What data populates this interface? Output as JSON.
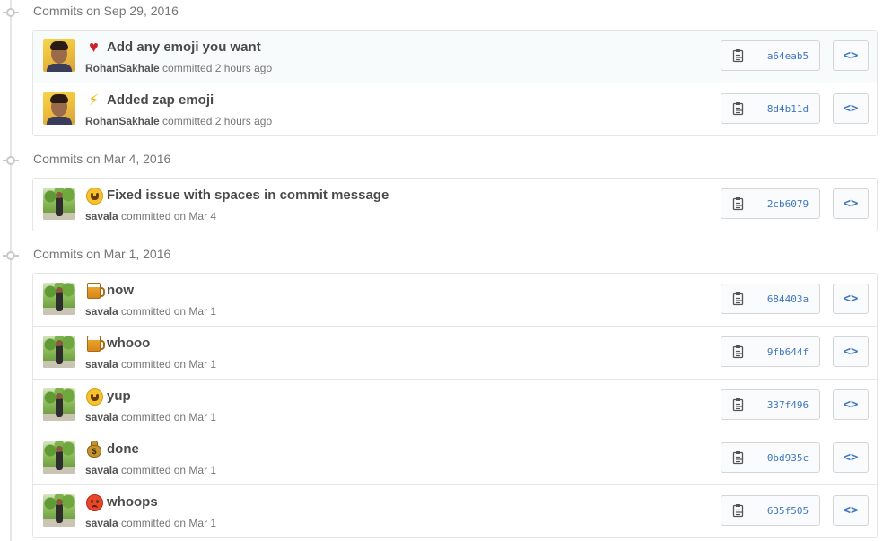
{
  "groups": [
    {
      "title": "Commits on Sep 29, 2016",
      "commits": [
        {
          "emoji": "heart",
          "message": "Add any emoji you want",
          "author": "RohanSakhale",
          "verb": "committed",
          "when": "2 hours ago",
          "sha": "a64eab5",
          "avatar": "rohan"
        },
        {
          "emoji": "zap",
          "message": "Added zap emoji",
          "author": "RohanSakhale",
          "verb": "committed",
          "when": "2 hours ago",
          "sha": "8d4b11d",
          "avatar": "rohan"
        }
      ]
    },
    {
      "title": "Commits on Mar 4, 2016",
      "commits": [
        {
          "emoji": "smiley",
          "message": "Fixed issue with spaces in commit message",
          "author": "savala",
          "verb": "committed",
          "when": "on Mar 4",
          "sha": "2cb6079",
          "avatar": "savala"
        }
      ]
    },
    {
      "title": "Commits on Mar 1, 2016",
      "commits": [
        {
          "emoji": "beer",
          "message": "now",
          "author": "savala",
          "verb": "committed",
          "when": "on Mar 1",
          "sha": "684403a",
          "avatar": "savala"
        },
        {
          "emoji": "beer",
          "message": "whooo",
          "author": "savala",
          "verb": "committed",
          "when": "on Mar 1",
          "sha": "9fb644f",
          "avatar": "savala"
        },
        {
          "emoji": "smiley",
          "message": "yup",
          "author": "savala",
          "verb": "committed",
          "when": "on Mar 1",
          "sha": "337f496",
          "avatar": "savala"
        },
        {
          "emoji": "moneybag",
          "message": "done",
          "author": "savala",
          "verb": "committed",
          "when": "on Mar 1",
          "sha": "0bd935c",
          "avatar": "savala"
        },
        {
          "emoji": "rage",
          "message": "whoops",
          "author": "savala",
          "verb": "committed",
          "when": "on Mar 1",
          "sha": "635f505",
          "avatar": "savala"
        }
      ]
    }
  ],
  "browse_label": "<>",
  "colors": {
    "link": "#4078c0",
    "row_highlight": "#f7fbfc",
    "border": "#e5e5e5"
  }
}
